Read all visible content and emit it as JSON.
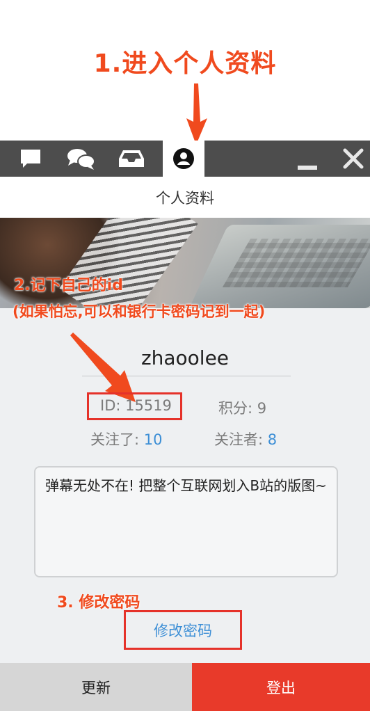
{
  "annotations": {
    "step1": "1.进入个人资料",
    "step2_line1": "2.记下自己的id",
    "step2_line2": "(如果怕忘,可以和银行卡密码记到一起)",
    "step3": "3. 修改密码"
  },
  "toolbar": {
    "tabs": [
      {
        "icon": "chat-bubble-icon",
        "active": false
      },
      {
        "icon": "chats-icon",
        "active": false
      },
      {
        "icon": "inbox-icon",
        "active": false
      },
      {
        "icon": "user-icon",
        "active": true
      }
    ],
    "controls": [
      {
        "icon": "minimize-icon"
      },
      {
        "icon": "close-icon"
      }
    ]
  },
  "page": {
    "title": "个人资料"
  },
  "profile": {
    "username": "zhaoolee",
    "id_text": "ID: 15519",
    "points_label": "积分: ",
    "points_value": "9",
    "following_label": "关注了: ",
    "following_value": "10",
    "followers_label": "关注者: ",
    "followers_value": "8",
    "signature": "弹幕无处不在! 把整个互联网划入B站的版图~"
  },
  "actions": {
    "change_password": "修改密码",
    "refresh": "更新",
    "logout": "登出"
  },
  "colors": {
    "annotation": "#f04a1e",
    "toolbar": "#4d4d4d",
    "link": "#3d8fd6",
    "logout": "#e83a2a"
  }
}
